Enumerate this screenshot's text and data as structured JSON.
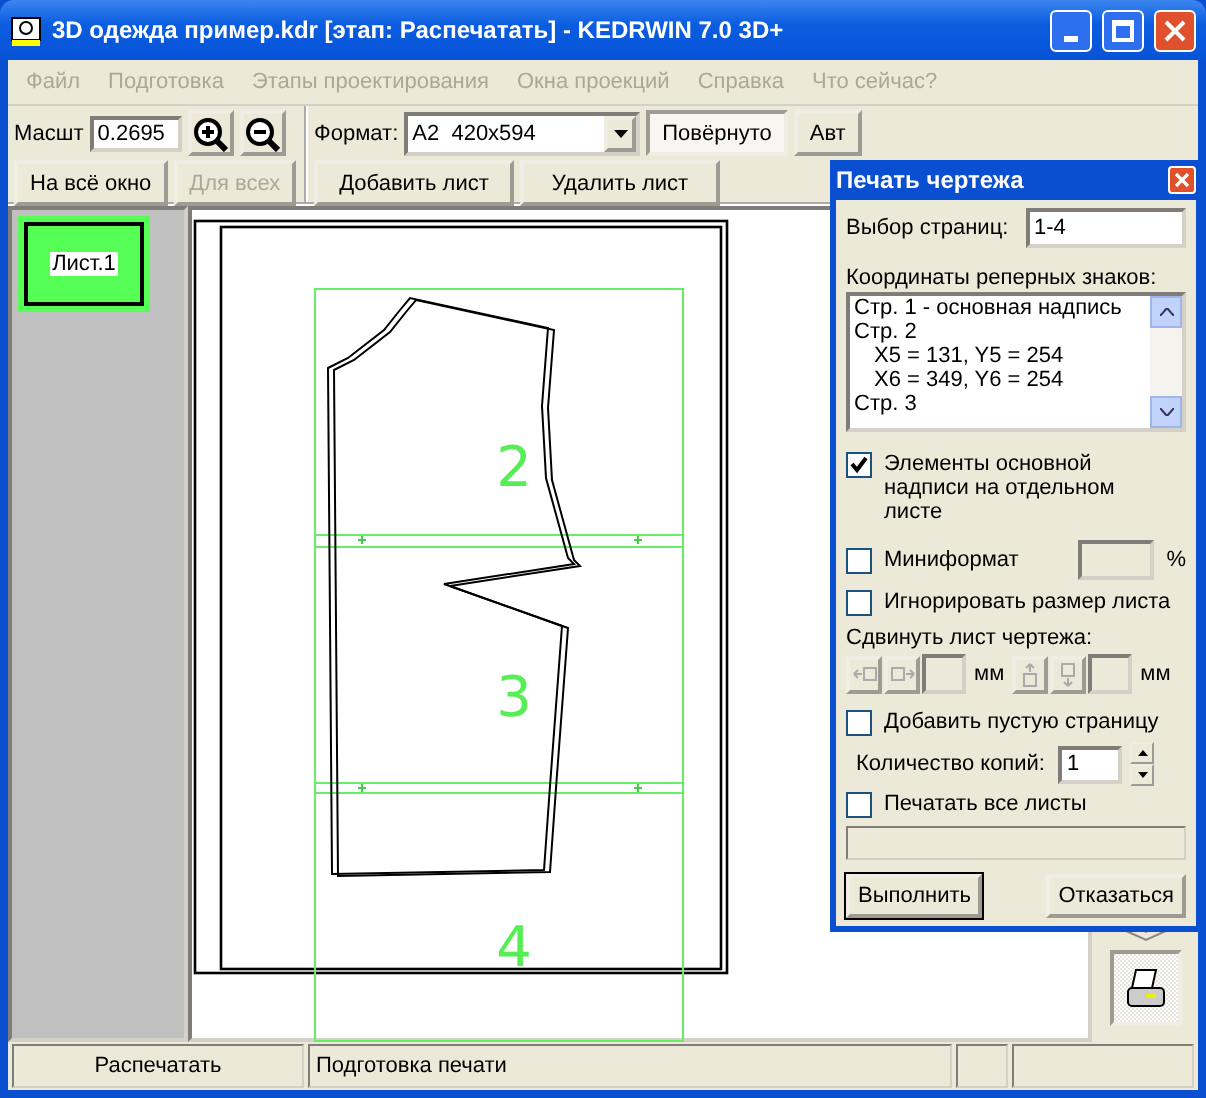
{
  "window": {
    "title": "3D одежда пример.kdr [этап: Распечатать] - KEDRWIN 7.0 3D+"
  },
  "menu": [
    {
      "label": "Файл",
      "disabled": true
    },
    {
      "label": "Подготовка",
      "disabled": true
    },
    {
      "label": "Этапы проектирования",
      "disabled": true
    },
    {
      "label": "Окна проекций",
      "disabled": true
    },
    {
      "label": "Справка",
      "disabled": true
    },
    {
      "label": "Что сейчас?",
      "disabled": true
    }
  ],
  "toolbar": {
    "scale_label": "Масшт",
    "scale_value": "0.2695",
    "fit_button": {
      "label": "На всё окно",
      "disabled": false
    },
    "all_button": {
      "label": "Для всех",
      "disabled": true
    },
    "format_label": "Формат:",
    "format_value": "A2  420x594",
    "rotated_button": {
      "label": "Повёрнуто",
      "pressed": true
    },
    "auto_button": {
      "label": "Авт",
      "pressed": false
    },
    "add_sheet": "Добавить лист",
    "delete_sheet": "Удалить лист"
  },
  "sheets": [
    {
      "label": "Лист.1",
      "selected": true
    }
  ],
  "drawing": {
    "page_labels": [
      "2",
      "3",
      "4"
    ]
  },
  "dialog": {
    "title": "Печать чертежа",
    "pages_label": "Выбор страниц:",
    "pages_value": "1-4",
    "marks_label": "Координаты реперных знаков:",
    "marks": [
      {
        "text": "Стр. 1 - основная надпись"
      },
      {
        "text": "Стр. 2",
        "children": [
          {
            "text": "X5 = 131, Y5 = 254"
          },
          {
            "text": "X6 = 349, Y6 = 254"
          }
        ]
      },
      {
        "text": "Стр. 3"
      }
    ],
    "separate_title_block": {
      "label": "Элементы основной надписи на отдельном листе",
      "checked": true
    },
    "miniformat": {
      "label": "Миниформат",
      "checked": false,
      "unit": "%"
    },
    "ignore_size": {
      "label": "Игнорировать размер листа",
      "checked": false
    },
    "shift_label": "Сдвинуть лист чертежа:",
    "shift_units": [
      "мм",
      "мм"
    ],
    "blank_page": {
      "label": "Добавить пустую страницу",
      "checked": false
    },
    "copies_label": "Количество копий:",
    "copies_value": "1",
    "print_all": {
      "label": "Печатать все листы",
      "checked": false
    },
    "progress": {
      "level": 0
    },
    "buttons": [
      {
        "label": "Выполнить",
        "default": true
      },
      {
        "label": "Отказаться",
        "default": false
      }
    ]
  },
  "status_bar": [
    "Распечатать",
    "Подготовка печати"
  ]
}
